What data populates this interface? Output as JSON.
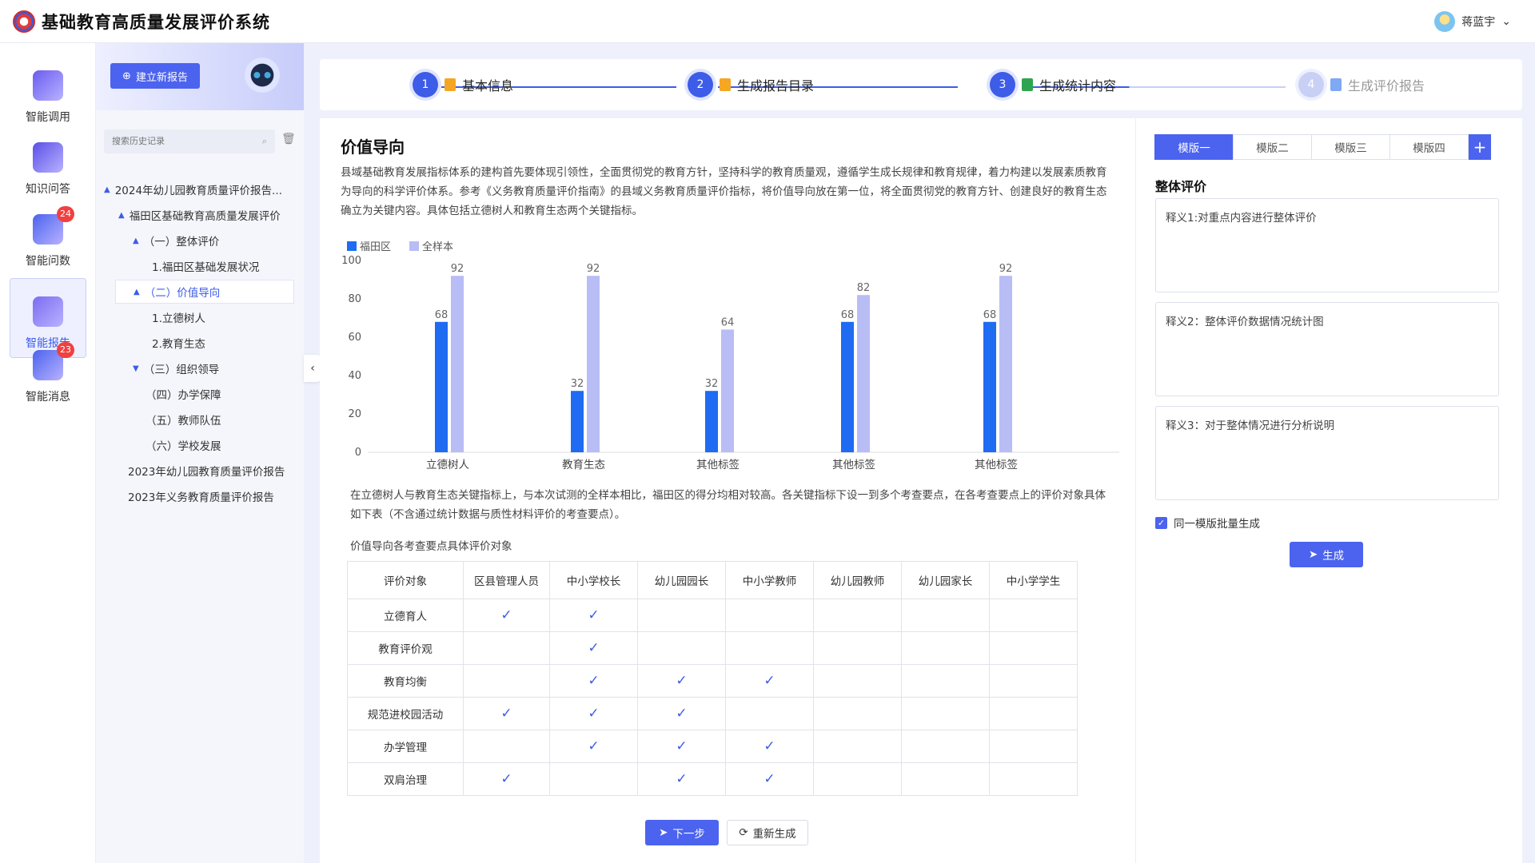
{
  "app": {
    "title": "基础教育高质量发展评价系统"
  },
  "user": {
    "name": "蒋蓝宇"
  },
  "nav": [
    {
      "label": "智能调用",
      "icon": "box-icon"
    },
    {
      "label": "知识问答",
      "icon": "document-icon"
    },
    {
      "label": "智能问数",
      "icon": "stats-icon",
      "badge": "24"
    },
    {
      "label": "智能报告",
      "icon": "report-icon",
      "active": true
    },
    {
      "label": "智能消息",
      "icon": "chat-icon",
      "badge": "23"
    }
  ],
  "sidebar": {
    "new_report": "建立新报告",
    "search_placeholder": "搜索历史记录",
    "tree": [
      {
        "label": "2024年幼儿园教育质量评价报告...",
        "arrow": "▲"
      },
      {
        "label": "福田区基础教育高质量发展评价",
        "arrow": "▲"
      },
      {
        "label": "（一）整体评价",
        "arrow": "▲"
      },
      {
        "label": "1.福田区基础发展状况",
        "arrow": ""
      },
      {
        "label": "（二）价值导向",
        "arrow": "▲",
        "selected": true
      },
      {
        "label": "1.立德树人",
        "arrow": ""
      },
      {
        "label": "2.教育生态",
        "arrow": ""
      },
      {
        "label": "（三）组织领导",
        "arrow": "▼"
      },
      {
        "label": "（四）办学保障",
        "arrow": ""
      },
      {
        "label": "（五）教师队伍",
        "arrow": ""
      },
      {
        "label": "（六）学校发展",
        "arrow": ""
      },
      {
        "label": "2023年幼儿园教育质量评价报告",
        "arrow": ""
      },
      {
        "label": "2023年义务教育质量评价报告",
        "arrow": ""
      }
    ]
  },
  "steps": [
    {
      "num": "1",
      "label": "基本信息"
    },
    {
      "num": "2",
      "label": "生成报告目录"
    },
    {
      "num": "3",
      "label": "生成统计内容"
    },
    {
      "num": "4",
      "label": "生成评价报告"
    }
  ],
  "main": {
    "title": "价值导向",
    "intro": "县域基础教育发展指标体系的建构首先要体现引领性，全面贯彻党的教育方针，坚持科学的教育质量观，遵循学生成长规律和教育规律，着力构建以发展素质教育为导向的科学评价体系。参考《义务教育质量评价指南》的县域义务教育质量评价指标，将价值导向放在第一位，将全面贯彻党的教育方针、创建良好的教育生态确立为关键内容。具体包括立德树人和教育生态两个关键指标。",
    "analysis": "在立德树人与教育生态关键指标上，与本次试测的全样本相比，福田区的得分均相对较高。各关键指标下设一到多个考查要点，在各考查要点上的评价对象具体如下表（不含通过统计数据与质性材料评价的考查要点）。",
    "table_title": "价值导向各考查要点具体评价对象",
    "table_headers": [
      "评价对象",
      "区县管理人员",
      "中小学校长",
      "幼儿园园长",
      "中小学教师",
      "幼儿园教师",
      "幼儿园家长",
      "中小学学生"
    ],
    "table_rows": [
      {
        "name": "立德育人",
        "checks": [
          true,
          true,
          false,
          false,
          false,
          false,
          false
        ]
      },
      {
        "name": "教育评价观",
        "checks": [
          false,
          true,
          false,
          false,
          false,
          false,
          false
        ]
      },
      {
        "name": "教育均衡",
        "checks": [
          false,
          true,
          true,
          true,
          false,
          false,
          false
        ]
      },
      {
        "name": "规范进校园活动",
        "checks": [
          true,
          true,
          true,
          false,
          false,
          false,
          false
        ]
      },
      {
        "name": "办学管理",
        "checks": [
          false,
          true,
          true,
          true,
          false,
          false,
          false
        ]
      },
      {
        "name": "双肩治理",
        "checks": [
          true,
          false,
          true,
          true,
          false,
          false,
          false
        ]
      }
    ],
    "btn_next": "下一步",
    "btn_regen": "重新生成"
  },
  "right": {
    "tabs": [
      "模版一",
      "模版二",
      "模版三",
      "模版四"
    ],
    "add": "+",
    "section_title": "整体评价",
    "notes": [
      "释义1:对重点内容进行整体评价",
      "释义2：整体评价数据情况统计图",
      "释义3：对于整体情况进行分析说明"
    ],
    "batch_label": "同一模版批量生成",
    "generate": "生成"
  },
  "chart_data": {
    "type": "bar",
    "categories": [
      "立德树人",
      "教育生态",
      "其他标签",
      "其他标签",
      "其他标签"
    ],
    "series": [
      {
        "name": "福田区",
        "values": [
          68,
          32,
          32,
          68,
          68
        ],
        "color": "#1f6bf2"
      },
      {
        "name": "全样本",
        "values": [
          92,
          92,
          64,
          82,
          92
        ],
        "color": "#b8bdf5"
      }
    ],
    "ylim": [
      0,
      100
    ],
    "yticks": [
      0,
      20,
      40,
      60,
      80,
      100
    ],
    "legend": "top-left",
    "grid": false
  }
}
